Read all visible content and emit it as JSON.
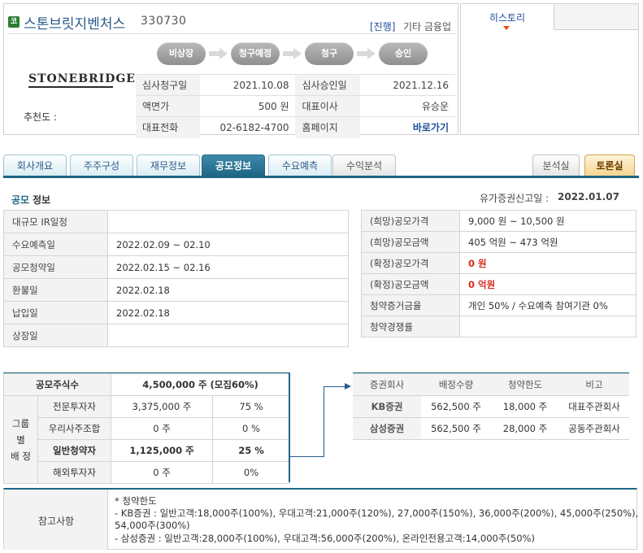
{
  "company": {
    "market_badge": "코",
    "name": "스톤브릿지벤처스",
    "code": "330730",
    "status": "[진행]",
    "industry": "기타 금융업",
    "logo_text": "STONEBRIDGE",
    "recommend_label": "추천도 :"
  },
  "steps": [
    "비상장",
    "청구예정",
    "청구",
    "승인"
  ],
  "info": {
    "review_request_label": "심사청구일",
    "review_request_value": "2021.10.08",
    "review_approval_label": "심사승인일",
    "review_approval_value": "2021.12.16",
    "par_value_label": "액면가",
    "par_value_value": "500 원",
    "ceo_label": "대표이사",
    "ceo_value": "유승운",
    "phone_label": "대표전화",
    "phone_value": "02-6182-4700",
    "homepage_label": "홈페이지",
    "homepage_value": "바로가기"
  },
  "history": {
    "tab_label": "히스토리"
  },
  "tabs": {
    "left": [
      "회사개요",
      "주주구성",
      "재무정보",
      "공모정보",
      "수요예측",
      "수익분석"
    ],
    "active_index": 3,
    "right": [
      "분석실",
      "토론실"
    ]
  },
  "section": {
    "title_part1": "공모",
    "title_part2": "정보",
    "filing_label": "유가증권신고일 :",
    "filing_date": "2022.01.07"
  },
  "schedule": [
    {
      "label": "대규모 IR일정",
      "value": ""
    },
    {
      "label": "수요예측일",
      "value": "2022.02.09 ~ 02.10"
    },
    {
      "label": "공모청약일",
      "value": "2022.02.15 ~ 02.16"
    },
    {
      "label": "환불일",
      "value": "2022.02.18"
    },
    {
      "label": "납입일",
      "value": "2022.02.18"
    },
    {
      "label": "상장일",
      "value": ""
    }
  ],
  "offering": [
    {
      "label": "(희망)공모가격",
      "value": "9,000 원 ~ 10,500 원"
    },
    {
      "label": "(희망)공모금액",
      "value": "405 억원   ~ 473 억원"
    },
    {
      "label": "(확정)공모가격",
      "value": "0 원"
    },
    {
      "label": "(확정)공모금액",
      "value": "0 억원"
    },
    {
      "label": "청약증거금율",
      "value": "개인 50% / 수요예측 참여기관 0%"
    },
    {
      "label": "청약경쟁률",
      "value": ""
    }
  ],
  "allocation": {
    "total_label": "공모주식수",
    "total_value": "4,500,000  주 (모집60%)",
    "group_label_line1": "그룹별",
    "group_label_line2": "배  정",
    "rows": [
      {
        "label": "전문투자자",
        "shares": "3,375,000 주",
        "pct": "75 %"
      },
      {
        "label": "우리사주조합",
        "shares": "0 주",
        "pct": "0 %"
      },
      {
        "label": "일반청약자",
        "shares": "1,125,000  주",
        "pct": "25 %"
      },
      {
        "label": "해외투자자",
        "shares": "0 주",
        "pct": "0%"
      }
    ]
  },
  "underwriters": {
    "headers": [
      "증권회사",
      "배정수량",
      "청약한도",
      "비고"
    ],
    "rows": [
      {
        "name": "KB증권",
        "qty": "562,500 주",
        "limit": "18,000 주",
        "note": "대표주관회사"
      },
      {
        "name": "삼성증권",
        "qty": "562,500 주",
        "limit": "28,000 주",
        "note": "공동주관회사"
      }
    ]
  },
  "notes": {
    "label": "참고사항",
    "lines": [
      "* 청약한도",
      "- KB증권 : 일반고객:18,000주(100%), 우대고객:21,000주(120%), 27,000주(150%), 36,000주(200%), 45,000주(250%),",
      "54,000주(300%)",
      "- 삼성증권 : 일반고객:28,000주(100%), 우대고객:56,000주(200%), 온라인전용고객:14,000주(50%)"
    ]
  }
}
